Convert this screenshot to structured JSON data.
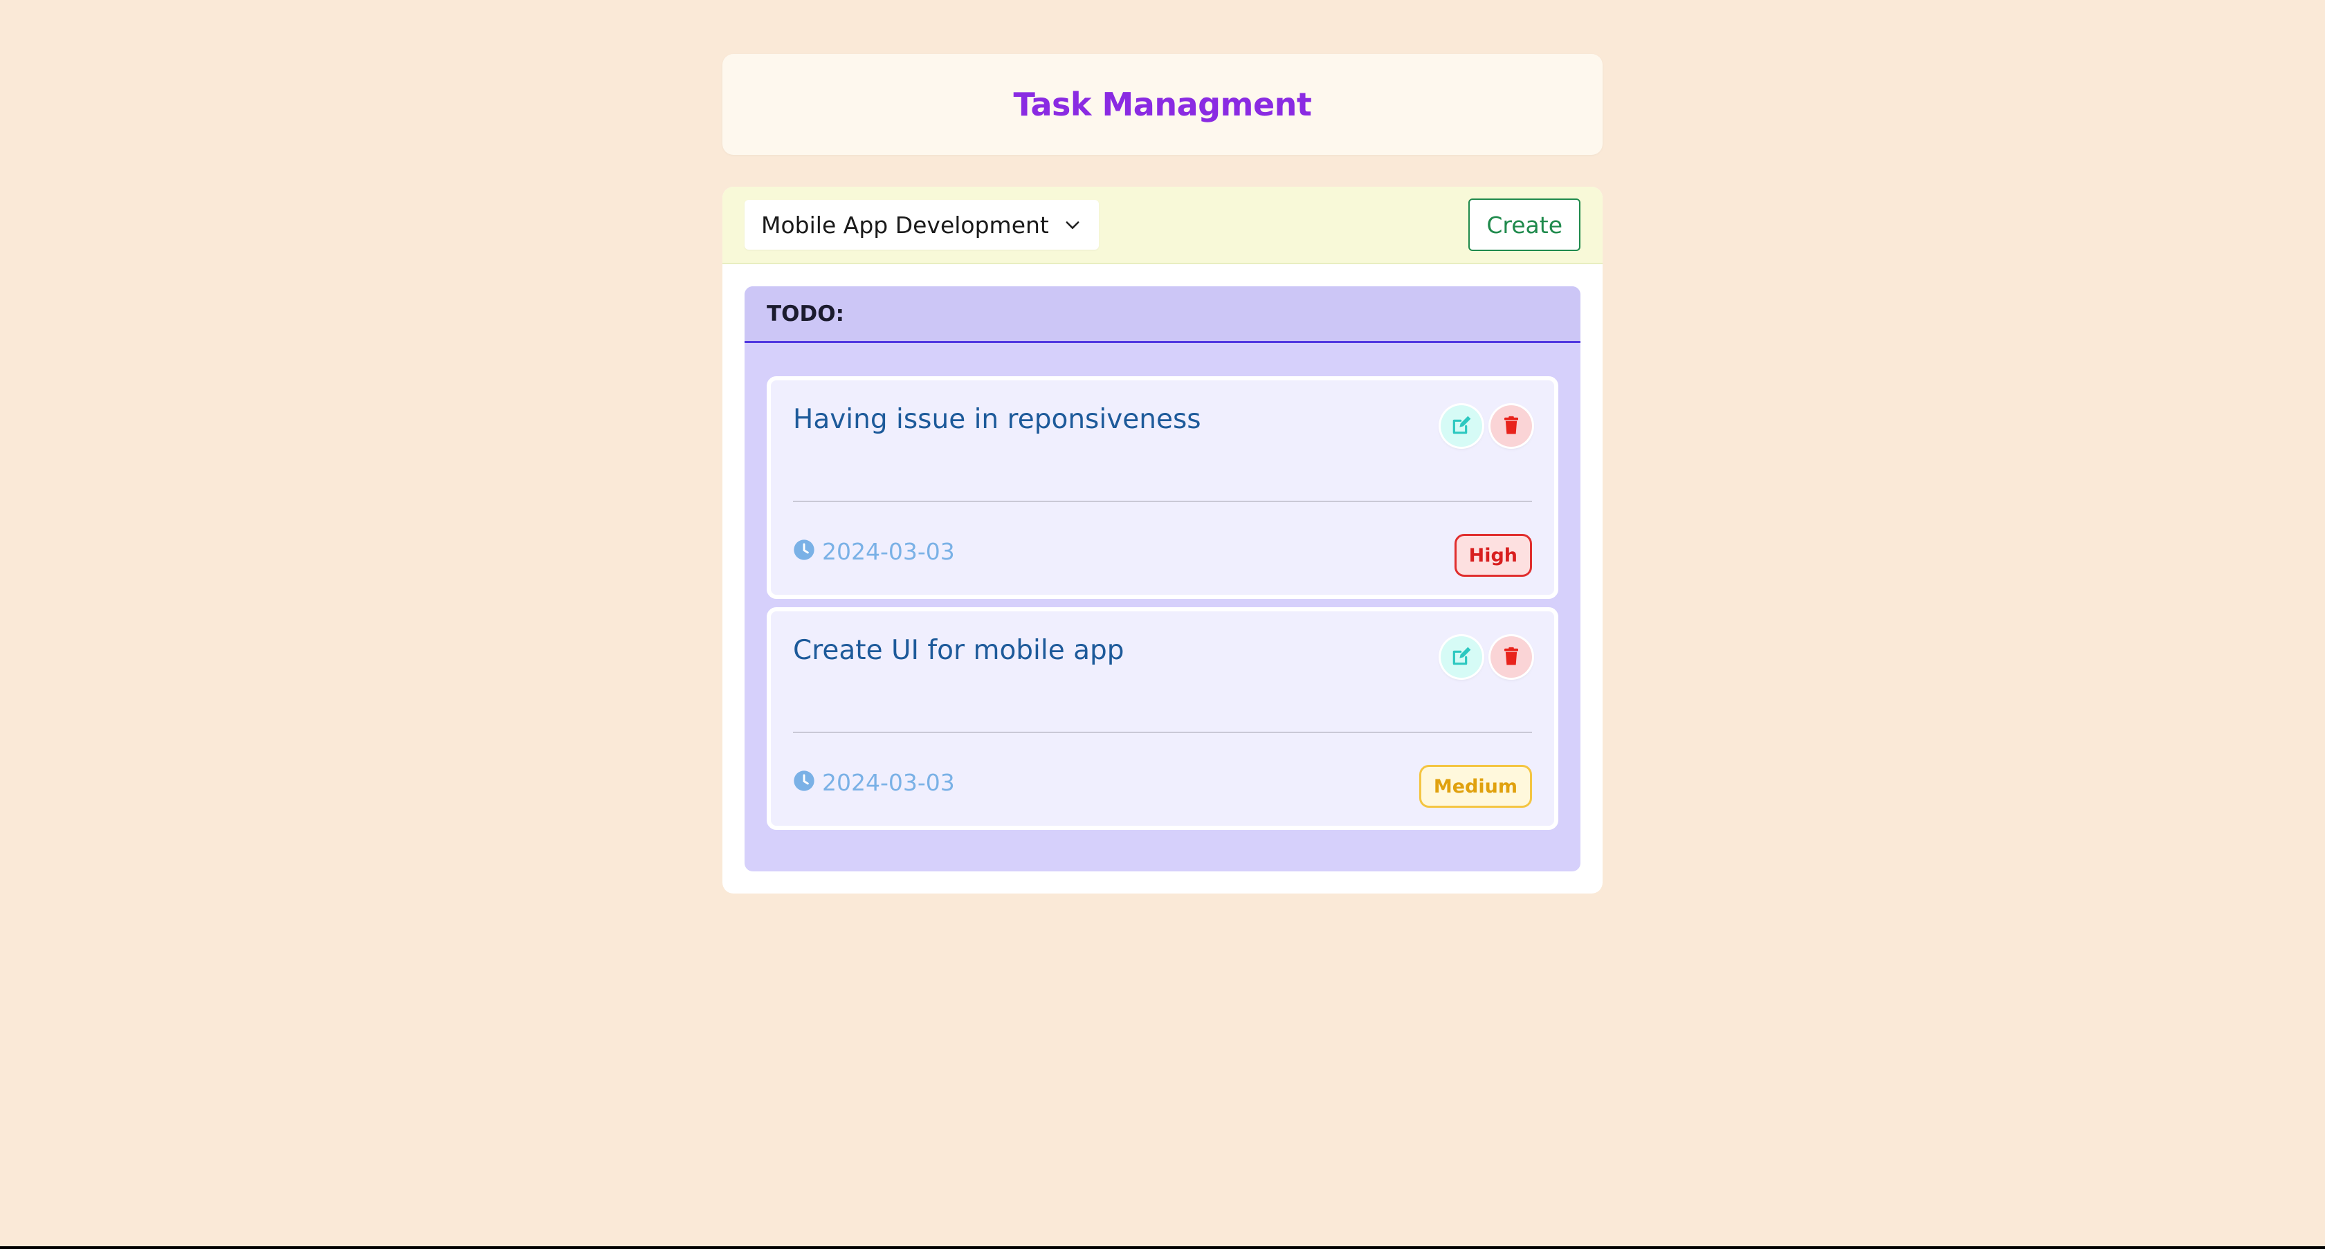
{
  "header": {
    "title": "Task Managment"
  },
  "toolbar": {
    "project_selected": "Mobile App Development",
    "create_label": "Create"
  },
  "column": {
    "title": "TODO:",
    "cards": [
      {
        "title": "Having issue in reponsiveness",
        "date": "2024-03-03",
        "priority": "High"
      },
      {
        "title": "Create UI for mobile app",
        "date": "2024-03-03",
        "priority": "Medium"
      }
    ]
  },
  "icons": {
    "edit": "edit-icon",
    "delete": "trash-icon",
    "clock": "clock-icon",
    "chevron": "chevron-down-icon"
  },
  "colors": {
    "page_background": "#fae9d7",
    "title": "#8a2be2",
    "create_button": "#1f8a4c",
    "column_background": "#d6d0fb",
    "column_accent": "#5138e0",
    "card_title": "#1d5a9a",
    "date": "#7ab1e6",
    "priority_high": "#d81f1f",
    "priority_medium": "#e0a10e"
  }
}
